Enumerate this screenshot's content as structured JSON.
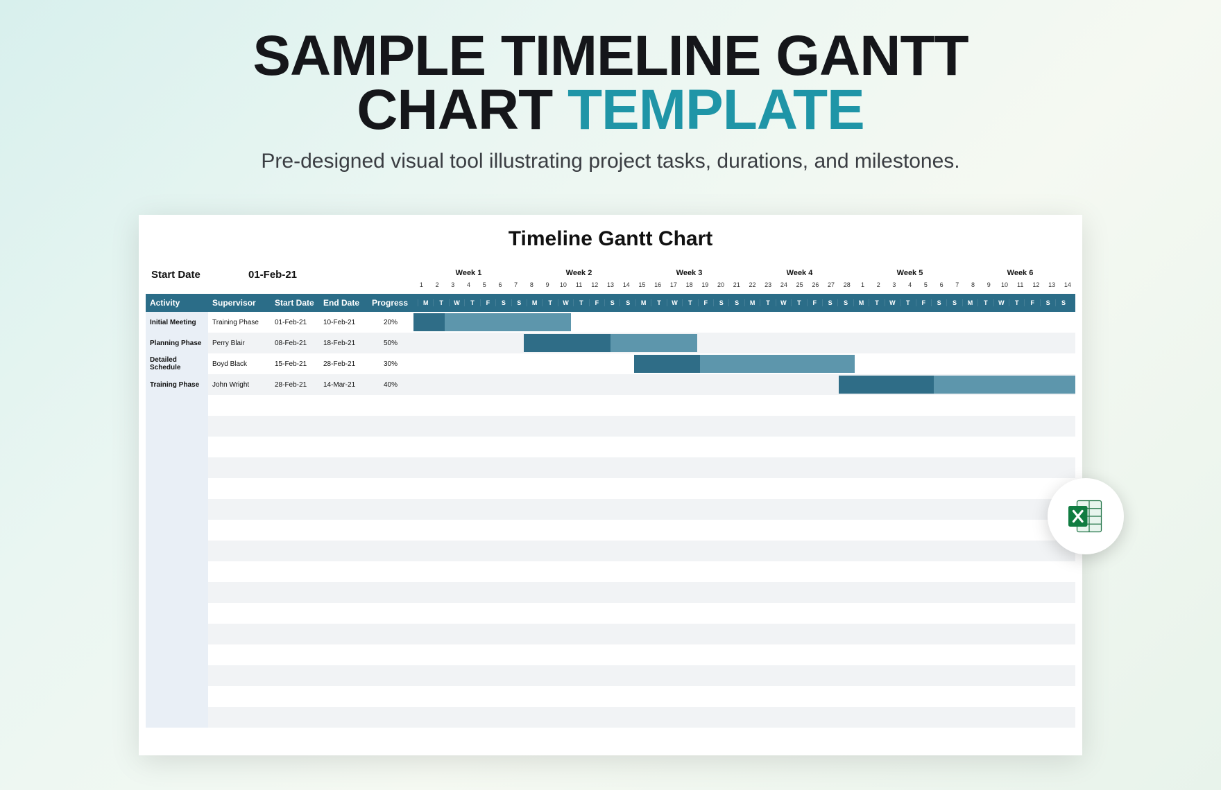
{
  "page": {
    "title_line1": "SAMPLE TIMELINE GANTT",
    "title_line2_prefix": "CHART ",
    "title_line2_accent": "TEMPLATE",
    "subtitle": "Pre-designed visual tool illustrating project tasks, durations, and milestones."
  },
  "sheet": {
    "title": "Timeline Gantt Chart",
    "start_date_label": "Start Date",
    "start_date_value": "01-Feb-21",
    "headers": {
      "activity": "Activity",
      "supervisor": "Supervisor",
      "start": "Start Date",
      "end": "End Date",
      "progress": "Progress"
    }
  },
  "timeline": {
    "total_days": 42,
    "week_labels": [
      "Week 1",
      "Week 2",
      "Week 3",
      "Week 4",
      "Week 5",
      "Week 6"
    ],
    "day_numbers": [
      "1",
      "2",
      "3",
      "4",
      "5",
      "6",
      "7",
      "8",
      "9",
      "10",
      "11",
      "12",
      "13",
      "14",
      "15",
      "16",
      "17",
      "18",
      "19",
      "20",
      "21",
      "22",
      "23",
      "24",
      "25",
      "26",
      "27",
      "28",
      "1",
      "2",
      "3",
      "4",
      "5",
      "6",
      "7",
      "8",
      "9",
      "10",
      "11",
      "12",
      "13",
      "14"
    ],
    "day_letters": [
      "M",
      "T",
      "W",
      "T",
      "F",
      "S",
      "S",
      "M",
      "T",
      "W",
      "T",
      "F",
      "S",
      "S",
      "M",
      "T",
      "W",
      "T",
      "F",
      "S",
      "S",
      "M",
      "T",
      "W",
      "T",
      "F",
      "S",
      "S",
      "M",
      "T",
      "W",
      "T",
      "F",
      "S",
      "S",
      "M",
      "T",
      "W",
      "T",
      "F",
      "S",
      "S"
    ]
  },
  "tasks": [
    {
      "activity": "Initial Meeting",
      "supervisor": "Training Phase",
      "start": "01-Feb-21",
      "end": "10-Feb-21",
      "progress": "20%",
      "bar_start": 0,
      "bar_len": 10,
      "done_pct": 20
    },
    {
      "activity": "Planning Phase",
      "supervisor": "Perry Blair",
      "start": "08-Feb-21",
      "end": "18-Feb-21",
      "progress": "50%",
      "bar_start": 7,
      "bar_len": 11,
      "done_pct": 50
    },
    {
      "activity": "Detailed Schedule",
      "supervisor": "Boyd Black",
      "start": "15-Feb-21",
      "end": "28-Feb-21",
      "progress": "30%",
      "bar_start": 14,
      "bar_len": 14,
      "done_pct": 30
    },
    {
      "activity": "Training Phase",
      "supervisor": "John Wright",
      "start": "28-Feb-21",
      "end": "14-Mar-21",
      "progress": "40%",
      "bar_start": 27,
      "bar_len": 15,
      "done_pct": 40
    }
  ],
  "chart_data": {
    "type": "gantt",
    "title": "Timeline Gantt Chart",
    "start_date": "2021-02-01",
    "x_unit": "days",
    "x_range_days": 42,
    "weeks": [
      "Week 1",
      "Week 2",
      "Week 3",
      "Week 4",
      "Week 5",
      "Week 6"
    ],
    "series": [
      {
        "name": "Initial Meeting",
        "supervisor": "Training Phase",
        "start": "2021-02-01",
        "end": "2021-02-10",
        "duration_days": 10,
        "progress_pct": 20
      },
      {
        "name": "Planning Phase",
        "supervisor": "Perry Blair",
        "start": "2021-02-08",
        "end": "2021-02-18",
        "duration_days": 11,
        "progress_pct": 50
      },
      {
        "name": "Detailed Schedule",
        "supervisor": "Boyd Black",
        "start": "2021-02-15",
        "end": "2021-02-28",
        "duration_days": 14,
        "progress_pct": 30
      },
      {
        "name": "Training Phase",
        "supervisor": "John Wright",
        "start": "2021-02-28",
        "end": "2021-03-14",
        "duration_days": 15,
        "progress_pct": 40
      }
    ],
    "colors": {
      "bar": "#5d96ac",
      "done": "#2f6d87",
      "header": "#2b6d88"
    }
  },
  "icon": {
    "name": "excel-icon"
  }
}
